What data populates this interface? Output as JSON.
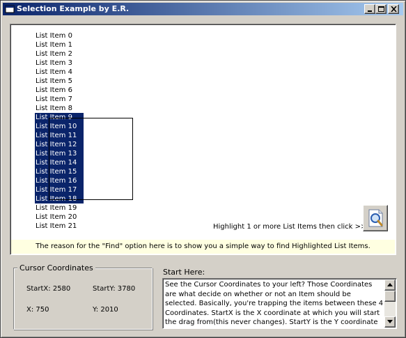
{
  "window": {
    "title": "Selection Example by E.R.",
    "controls": [
      "minimize-icon",
      "maximize-icon",
      "close-icon"
    ]
  },
  "list": {
    "items": [
      {
        "label": "List Item 0",
        "selected": false
      },
      {
        "label": "List Item 1",
        "selected": false
      },
      {
        "label": "List Item 2",
        "selected": false
      },
      {
        "label": "List Item 3",
        "selected": false
      },
      {
        "label": "List Item 4",
        "selected": false
      },
      {
        "label": "List Item 5",
        "selected": false
      },
      {
        "label": "List Item 6",
        "selected": false
      },
      {
        "label": "List Item 7",
        "selected": false
      },
      {
        "label": "List Item 8",
        "selected": false
      },
      {
        "label": "List Item 9",
        "selected": true
      },
      {
        "label": "List Item 10",
        "selected": true
      },
      {
        "label": "List Item 11",
        "selected": true
      },
      {
        "label": "List Item 12",
        "selected": true
      },
      {
        "label": "List Item 13",
        "selected": true
      },
      {
        "label": "List Item 14",
        "selected": true
      },
      {
        "label": "List Item 15",
        "selected": true
      },
      {
        "label": "List Item 16",
        "selected": true
      },
      {
        "label": "List Item 17",
        "selected": true
      },
      {
        "label": "List Item 18",
        "selected": true
      },
      {
        "label": "List Item 19",
        "selected": false
      },
      {
        "label": "List Item 20",
        "selected": false
      },
      {
        "label": "List Item 21",
        "selected": false
      }
    ]
  },
  "find": {
    "hint": "Highlight 1 or more List Items then click >>",
    "icon": "find-magnifier-icon"
  },
  "info_strip": {
    "text": "The reason for the \"Find\" option here is to show you a simple way to find Highlighted List Items."
  },
  "coords": {
    "title": "Cursor Coordinates",
    "startx": "StartX: 2580",
    "starty": "StartY: 3780",
    "x": "X: 750",
    "y": "Y: 2010"
  },
  "start_here": {
    "label": "Start Here:",
    "text": "See the Cursor Coordinates to your left? Those Coordinates are what decide on whether or not an Item should be selected. Basically, you're trapping the items between these 4 Coordinates. StartX is the X coordinate at which you will start the drag from(this never changes). StartY is the Y coordinate at"
  },
  "colors": {
    "selection": "#0a246a",
    "info_strip_bg": "#ffffe1",
    "window_bg": "#d4d0c8"
  }
}
